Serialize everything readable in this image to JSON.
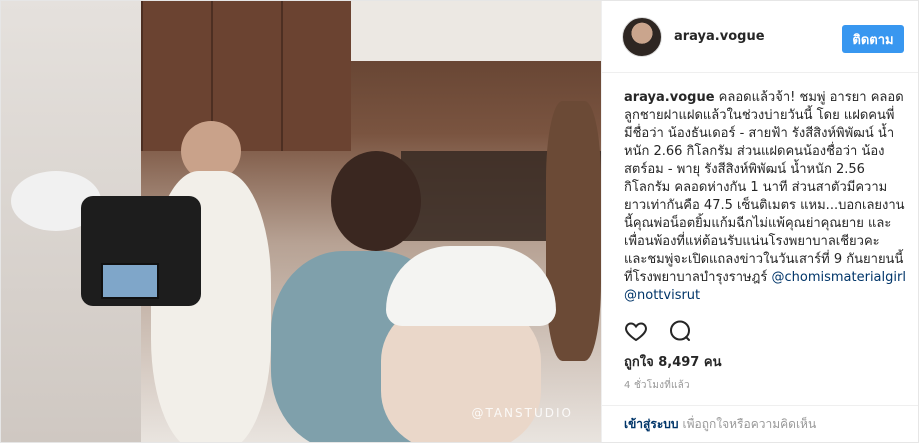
{
  "post": {
    "photo_watermark": "@TANSTUDIO",
    "username": "araya.vogue",
    "follow_label": "ติดตาม",
    "caption": {
      "username": "araya.vogue",
      "text": "คลอดแล้วจ้า! ชมพู่ อารยา คลอดลูกชายฝาแฝดแล้วในช่วงบ่ายวันนี้ โดย แฝดคนพี่ มีชื่อว่า น้องธันเดอร์ - สายฟ้า รังสีสิงห์พิพัฒน์ น้ำหนัก 2.66 กิโลกรัม ส่วนแฝดคนน้องชื่อว่า น้องสตร์อม - พายุ รังสีสิงห์พิพัฒน์ น้ำหนัก 2.56 กิโลกรัม คลอดห่างกัน 1 นาที ส่วนสาตัวมีความยาวเท่ากันคือ 47.5 เซ็นติเมตร แหม...บอกเลยงานนี้คุณพ่อน็อตยิ้มแก้มฉีกไม่แพ้คุณย่าคุณยาย และเพื่อนพ้องที่แห่ต้อนรับแน่นโรงพยาบาลเชียวคะ และชมพู่จะเปิดแถลงข่าวในวันเสาร์ที่ 9 กันยายนนี้ ที่โรงพยาบาลบำรุงราษฎร์",
      "tags": "@chomismaterialgirl @nottvisrut"
    },
    "likes_text": "ถูกใจ 8,497 คน",
    "time_text": "4 ชั่วโมงที่แล้ว",
    "footer": {
      "login_label": "เข้าสู่ระบบ",
      "rest_text": "เพื่อถูกใจหรือความคิดเห็น"
    },
    "icons": {
      "like": "heart-icon",
      "comment": "comment-icon"
    },
    "colors": {
      "follow": "#3897f0",
      "link": "#003569"
    }
  }
}
